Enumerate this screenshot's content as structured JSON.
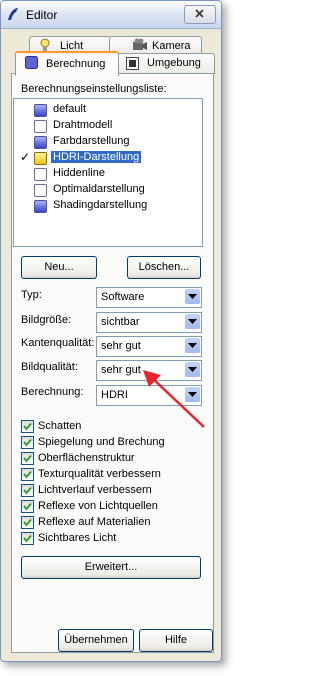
{
  "window": {
    "title": "Editor"
  },
  "tabs": {
    "back": [
      {
        "label": "Licht",
        "icon": "light-icon"
      },
      {
        "label": "Kamera",
        "icon": "camera-icon"
      }
    ],
    "front": [
      {
        "label": "Berechnung",
        "icon": "render-icon",
        "active": true
      },
      {
        "label": "Umgebung",
        "icon": "environment-icon"
      }
    ]
  },
  "list": {
    "label": "Berechnungseinstellungsliste:",
    "items": [
      {
        "label": "default",
        "icon": "blue"
      },
      {
        "label": "Drahtmodell",
        "icon": "plain"
      },
      {
        "label": "Farbdarstellung",
        "icon": "blue"
      },
      {
        "label": "HDRI-Darstellung",
        "icon": "yellow",
        "selected": true,
        "checked": true
      },
      {
        "label": "Hiddenline",
        "icon": "plain"
      },
      {
        "label": "Optimaldarstellung",
        "icon": "plain"
      },
      {
        "label": "Shadingdarstellung",
        "icon": "blue"
      }
    ]
  },
  "buttons": {
    "new": "Neu...",
    "delete": "Löschen...",
    "advanced": "Erweitert...",
    "apply": "Übernehmen",
    "help": "Hilfe"
  },
  "fields": [
    {
      "label": "Typ:",
      "value": "Software"
    },
    {
      "label": "Bildgröße:",
      "value": "sichtbar"
    },
    {
      "label": "Kantenqualität:",
      "value": "sehr gut"
    },
    {
      "label": "Bildqualität:",
      "value": "sehr gut"
    },
    {
      "label": "Berechnung:",
      "value": "HDRI"
    }
  ],
  "checkboxes": [
    {
      "label": "Schatten",
      "checked": true
    },
    {
      "label": "Spiegelung und Brechung",
      "checked": true
    },
    {
      "label": "Oberflächenstruktur",
      "checked": true
    },
    {
      "label": "Texturqualität verbessern",
      "checked": true
    },
    {
      "label": "Lichtverlauf verbessern",
      "checked": true
    },
    {
      "label": "Reflexe von Lichtquellen",
      "checked": true
    },
    {
      "label": "Reflexe auf Materialien",
      "checked": true
    },
    {
      "label": "Sichtbares Licht",
      "checked": true
    }
  ],
  "colors": {
    "selection": "#316ac5",
    "annotation_arrow": "#e8262b",
    "tab_highlight": "#ff9b26"
  }
}
